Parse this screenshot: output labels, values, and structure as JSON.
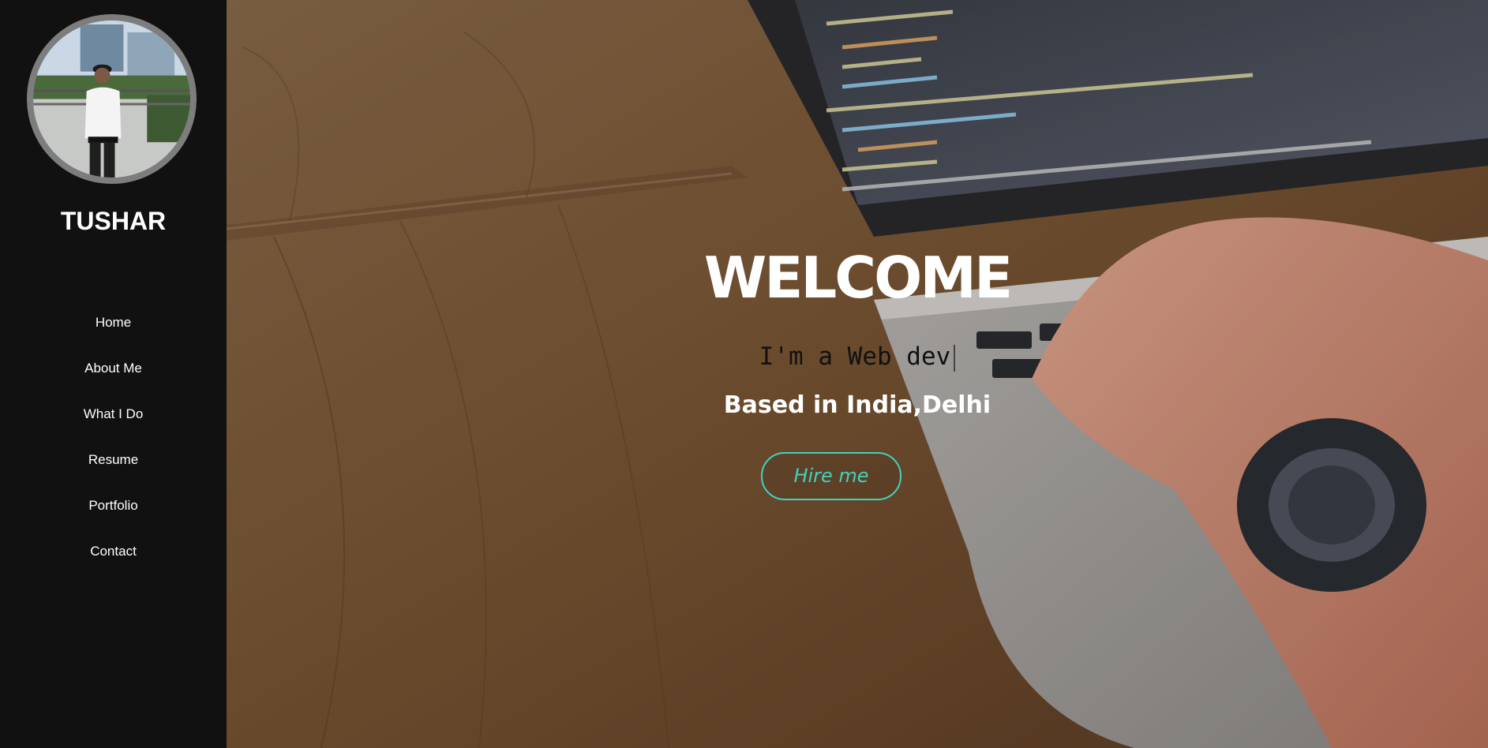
{
  "sidebar": {
    "brand": "TUSHAR",
    "nav": [
      {
        "label": "Home"
      },
      {
        "label": "About Me"
      },
      {
        "label": "What I Do"
      },
      {
        "label": "Resume"
      },
      {
        "label": "Portfolio"
      },
      {
        "label": "Contact"
      }
    ]
  },
  "hero": {
    "title": "WELCOME",
    "typed_text": "I'm a Web dev",
    "location": "Based in India,Delhi",
    "cta_label": "Hire me"
  },
  "colors": {
    "sidebar_bg": "#111111",
    "accent": "#3fd2c0",
    "avatar_border": "#7d7d7d"
  }
}
